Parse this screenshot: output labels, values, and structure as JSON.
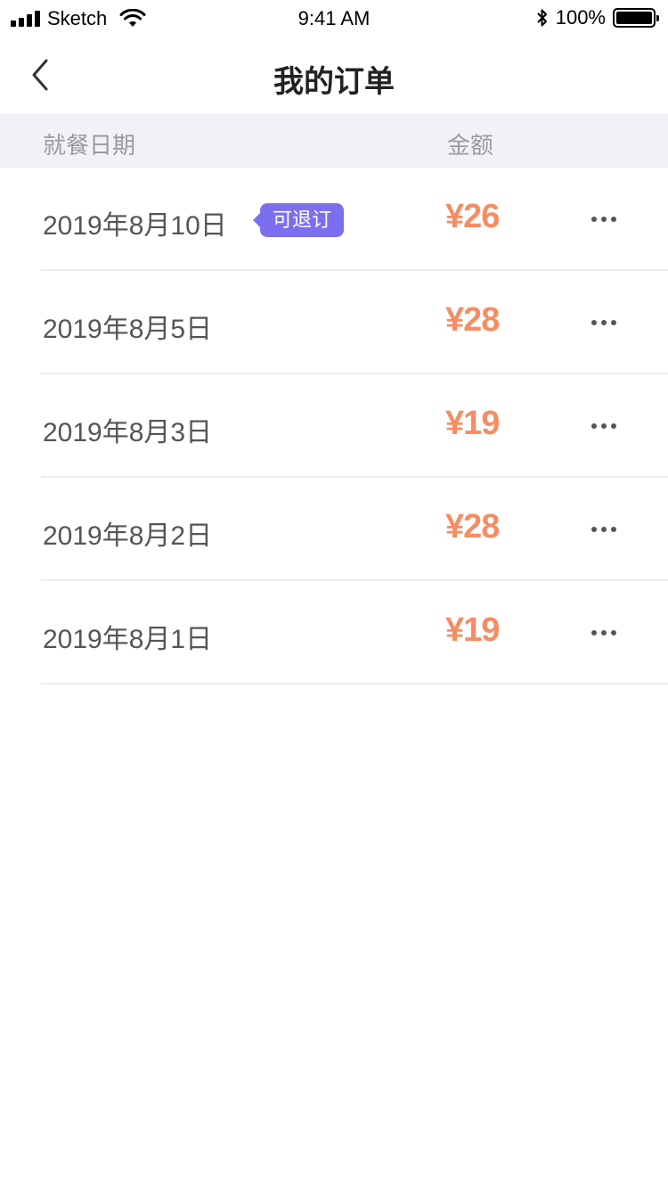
{
  "status_bar": {
    "carrier": "Sketch",
    "time": "9:41 AM",
    "battery": "100%"
  },
  "nav": {
    "title": "我的订单"
  },
  "table": {
    "headers": {
      "date": "就餐日期",
      "amount": "金额"
    },
    "rows": [
      {
        "date": "2019年8月10日",
        "badge": "可退订",
        "amount": "¥26"
      },
      {
        "date": "2019年8月5日",
        "badge": "",
        "amount": "¥28"
      },
      {
        "date": "2019年8月3日",
        "badge": "",
        "amount": "¥19"
      },
      {
        "date": "2019年8月2日",
        "badge": "",
        "amount": "¥28"
      },
      {
        "date": "2019年8月1日",
        "badge": "",
        "amount": "¥19"
      }
    ]
  },
  "colors": {
    "accent_badge": "#7b6ff0",
    "amount": "#f58d63",
    "header_bg": "#f2f2f6"
  },
  "icons": {
    "back": "chevron-left-icon",
    "more": "more-horizontal-icon"
  }
}
